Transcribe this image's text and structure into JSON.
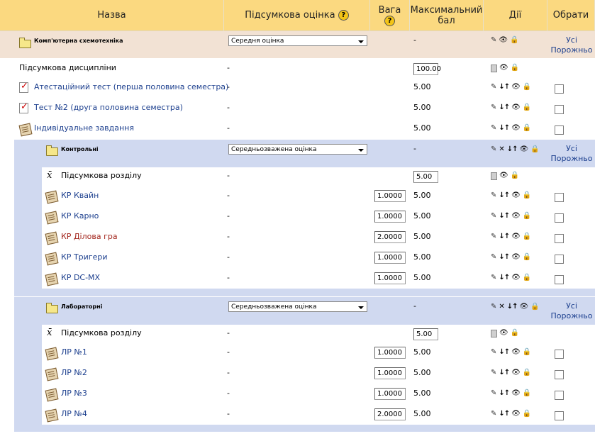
{
  "header": {
    "name": "Назва",
    "aggregation": "Підсумкова оцінка",
    "weight": "Вага",
    "max_grade": "Максимальний бал",
    "actions": "Дії",
    "select": "Обрати"
  },
  "select_links": {
    "all": "Усі",
    "none": "Порожньо"
  },
  "course": {
    "name": "Комп'ютерна схемотехніка",
    "aggregation": "Середня оцінка",
    "dash": "-"
  },
  "course_total": {
    "name": "Підсумкова дисципліни",
    "dash": "-",
    "max": "100.00"
  },
  "items_top": [
    {
      "name": "Атестаційний тест (перша половина семестра)",
      "dash": "-",
      "max": "5.00",
      "icon": "quiz-icon"
    },
    {
      "name": "Тест №2 (друга половина семестра)",
      "dash": "-",
      "max": "5.00",
      "icon": "quiz-icon"
    },
    {
      "name": "Індивідуальне завдання",
      "dash": "-",
      "max": "5.00",
      "icon": "assignment-icon"
    }
  ],
  "cat1": {
    "name": "Контрольні",
    "aggregation": "Середньозважена оцінка",
    "dash": "-",
    "total_name": "Підсумкова розділу",
    "total_dash": "-",
    "total_max": "5.00",
    "items": [
      {
        "name": "КР Квайн",
        "dash": "-",
        "weight": "1.0000",
        "max": "5.00"
      },
      {
        "name": "КР Карно",
        "dash": "-",
        "weight": "1.0000",
        "max": "5.00"
      },
      {
        "name": "КР Ділова гра",
        "dash": "-",
        "weight": "2.0000",
        "max": "5.00"
      },
      {
        "name": "КР Тригери",
        "dash": "-",
        "weight": "1.0000",
        "max": "5.00"
      },
      {
        "name": "КР DC-MX",
        "dash": "-",
        "weight": "1.0000",
        "max": "5.00"
      }
    ]
  },
  "cat2": {
    "name": "Лабораторні",
    "aggregation": "Середньозважена оцінка",
    "dash": "-",
    "total_name": "Підсумкова розділу",
    "total_dash": "-",
    "total_max": "5.00",
    "items": [
      {
        "name": "ЛР №1",
        "dash": "-",
        "weight": "1.0000",
        "max": "5.00"
      },
      {
        "name": "ЛР №2",
        "dash": "-",
        "weight": "1.0000",
        "max": "5.00"
      },
      {
        "name": "ЛР №3",
        "dash": "-",
        "weight": "1.0000",
        "max": "5.00"
      },
      {
        "name": "ЛР №4",
        "dash": "-",
        "weight": "2.0000",
        "max": "5.00"
      }
    ]
  },
  "colors": {
    "header": "#fbd980",
    "course_band": "#f2e2d4",
    "category_band": "#d0d9f0",
    "link": "#1c3f8e",
    "link_alt": "#a3261d"
  }
}
